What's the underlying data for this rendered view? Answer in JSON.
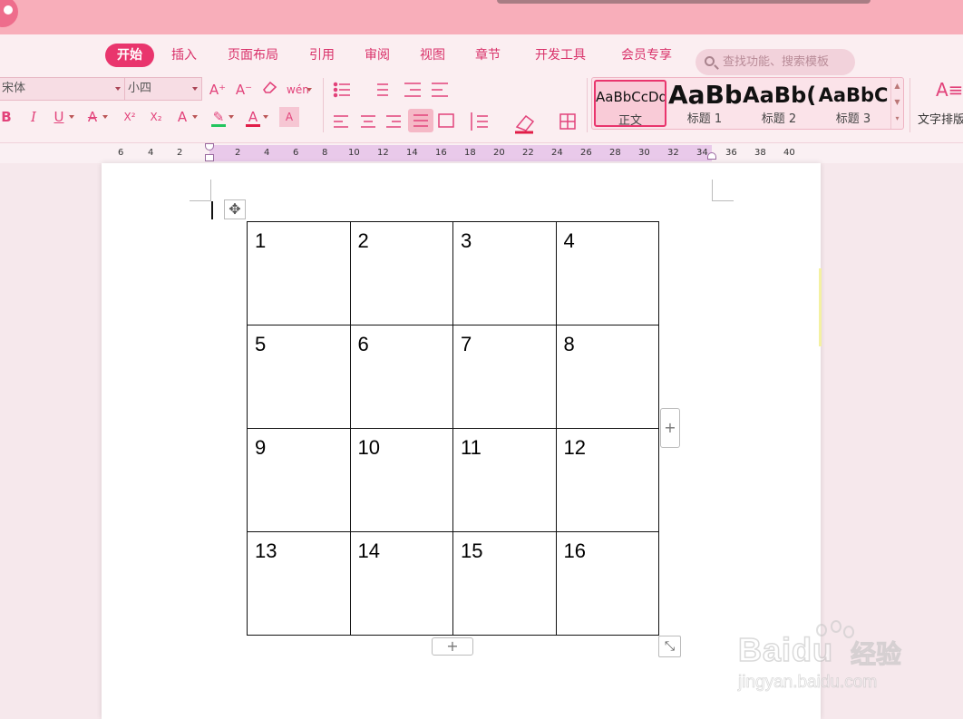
{
  "tabs": [
    "开始",
    "插入",
    "页面布局",
    "引用",
    "审阅",
    "视图",
    "章节",
    "开发工具",
    "会员专享"
  ],
  "search": {
    "placeholder": "查找功能、搜索模板"
  },
  "font": {
    "name": "宋体",
    "size": "小四"
  },
  "toolbar": {
    "grow_font": "A⁺",
    "shrink_font": "A⁻",
    "pinyin": "wén",
    "bold": "B",
    "italic": "I",
    "underline": "U",
    "strike": "A",
    "superscript": "X²",
    "subscript": "X₂",
    "text_effect": "A",
    "highlight": "✎",
    "font_color": "A",
    "char_shading": "A"
  },
  "styles": [
    {
      "preview": "AaBbCcDd",
      "label": "正文"
    },
    {
      "preview": "AaBb",
      "label": "标题 1"
    },
    {
      "preview": "AaBb(",
      "label": "标题 2"
    },
    {
      "preview": "AaBbC",
      "label": "标题 3"
    }
  ],
  "wordart": {
    "label": "文字排版"
  },
  "ruler": [
    "6",
    "4",
    "2",
    "2",
    "4",
    "6",
    "8",
    "10",
    "12",
    "14",
    "16",
    "18",
    "20",
    "22",
    "24",
    "26",
    "28",
    "30",
    "32",
    "34",
    "36",
    "38",
    "40"
  ],
  "table": {
    "rows": [
      [
        "1",
        "2",
        "3",
        "4"
      ],
      [
        "5",
        "6",
        "7",
        "8"
      ],
      [
        "9",
        "10",
        "11",
        "12"
      ],
      [
        "13",
        "14",
        "15",
        "16"
      ]
    ]
  },
  "handles": {
    "add": "+",
    "move": "✥",
    "resize": "⤡"
  },
  "watermark": {
    "brand": "Baidu",
    "cn": "经验",
    "url": "jingyan.baidu.com"
  },
  "colors": {
    "accent": "#e9356d",
    "titlebar": "#f8aeba",
    "highlight_bar": "#22c55e",
    "font_color_bar": "#e11d48"
  }
}
